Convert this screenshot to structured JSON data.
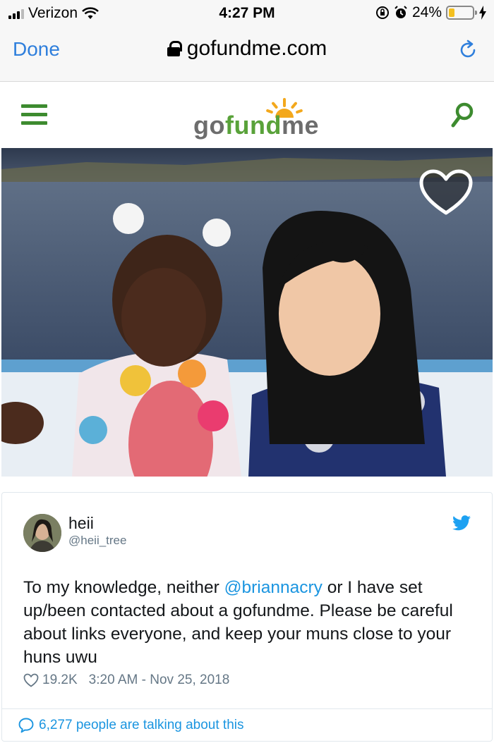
{
  "status_bar": {
    "carrier": "Verizon",
    "time": "4:27 PM",
    "battery_percent": "24%",
    "battery_level": 0.24,
    "icons": [
      "signal-icon",
      "wifi-icon",
      "rotation-lock-icon",
      "alarm-icon",
      "battery-icon",
      "charging-icon"
    ]
  },
  "browser": {
    "done_label": "Done",
    "url": "gofundme.com",
    "icons": [
      "lock-icon",
      "reload-icon"
    ],
    "accent_color": "#2f7fdc"
  },
  "gofundme_header": {
    "logo": {
      "part1": "go",
      "part2": "fund",
      "part3": "me"
    },
    "icons": [
      "hamburger-menu-icon",
      "search-icon"
    ],
    "brand_color": "#3d8b2f"
  },
  "photo": {
    "icons": [
      "heart-favorite-icon"
    ]
  },
  "tweet": {
    "display_name": "heii",
    "handle": "@heii_tree",
    "text_before": "To my knowledge, neither ",
    "mention": "@briannacry",
    "text_after": " or I have set up/been contacted about a gofundme. Please be careful about links everyone, and keep your muns close to your huns uwu",
    "likes": "19.2K",
    "timestamp": "3:20 AM - Nov 25, 2018",
    "talking": "6,277 people are talking about this",
    "link_color": "#1b95e0"
  }
}
